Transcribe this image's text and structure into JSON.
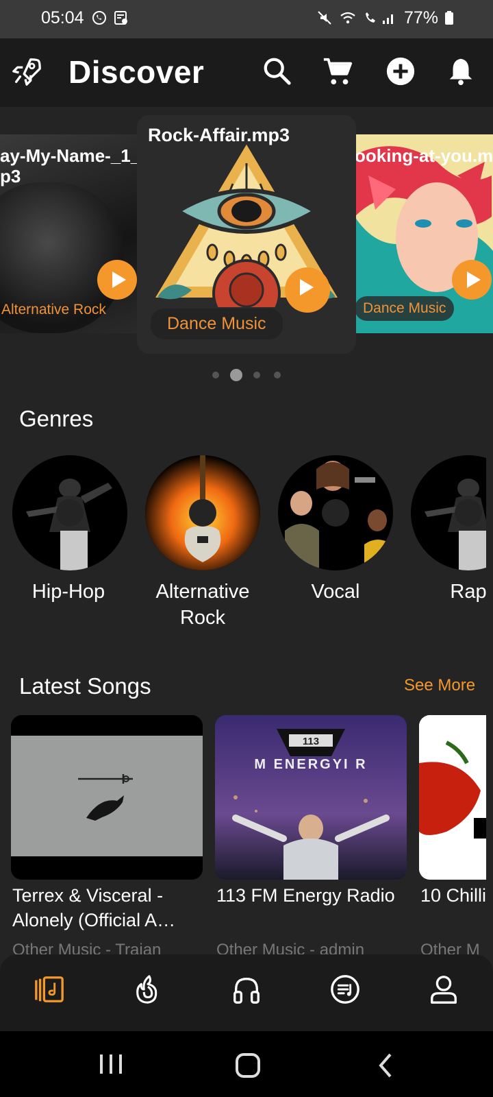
{
  "status_bar": {
    "time": "05:04",
    "battery": "77%"
  },
  "header": {
    "title": "Discover"
  },
  "carousel": {
    "items": [
      {
        "title_line1": "ay-My-Name-_1_.",
        "title_line2": "p3",
        "genre": "Alternative Rock"
      },
      {
        "title_line1": "Rock-Affair.mp3",
        "title_line2": "",
        "genre": "Dance Music"
      },
      {
        "title_line1": "ooking-at-you.m",
        "title_line2": "",
        "genre": "Dance Music"
      }
    ],
    "active_index": 1,
    "page_count": 4
  },
  "genres": {
    "title": "Genres",
    "items": [
      {
        "label": "Hip-Hop"
      },
      {
        "label": "Alternative Rock"
      },
      {
        "label": "Vocal"
      },
      {
        "label": "Rap"
      }
    ]
  },
  "latest": {
    "title": "Latest Songs",
    "see_more": "See More",
    "songs": [
      {
        "title": "Terrex & Visceral - Alonely (Official A…",
        "subtitle": "Other Music - Trajan"
      },
      {
        "title": "113 FM Energy Radio",
        "subtitle": "Other Music - admin"
      },
      {
        "title": "10 Chilli",
        "subtitle": "Other M"
      }
    ]
  },
  "colors": {
    "accent": "#f5982b",
    "background": "#242424",
    "header": "#1b1b1b"
  },
  "icons": {
    "header": [
      "rocket-icon",
      "search-icon",
      "cart-icon",
      "add-icon",
      "bell-icon"
    ],
    "bottom_nav": [
      "library-icon",
      "trending-icon",
      "headphones-icon",
      "playlist-icon",
      "profile-icon"
    ],
    "system_nav": [
      "recents-icon",
      "home-icon",
      "back-icon"
    ]
  }
}
